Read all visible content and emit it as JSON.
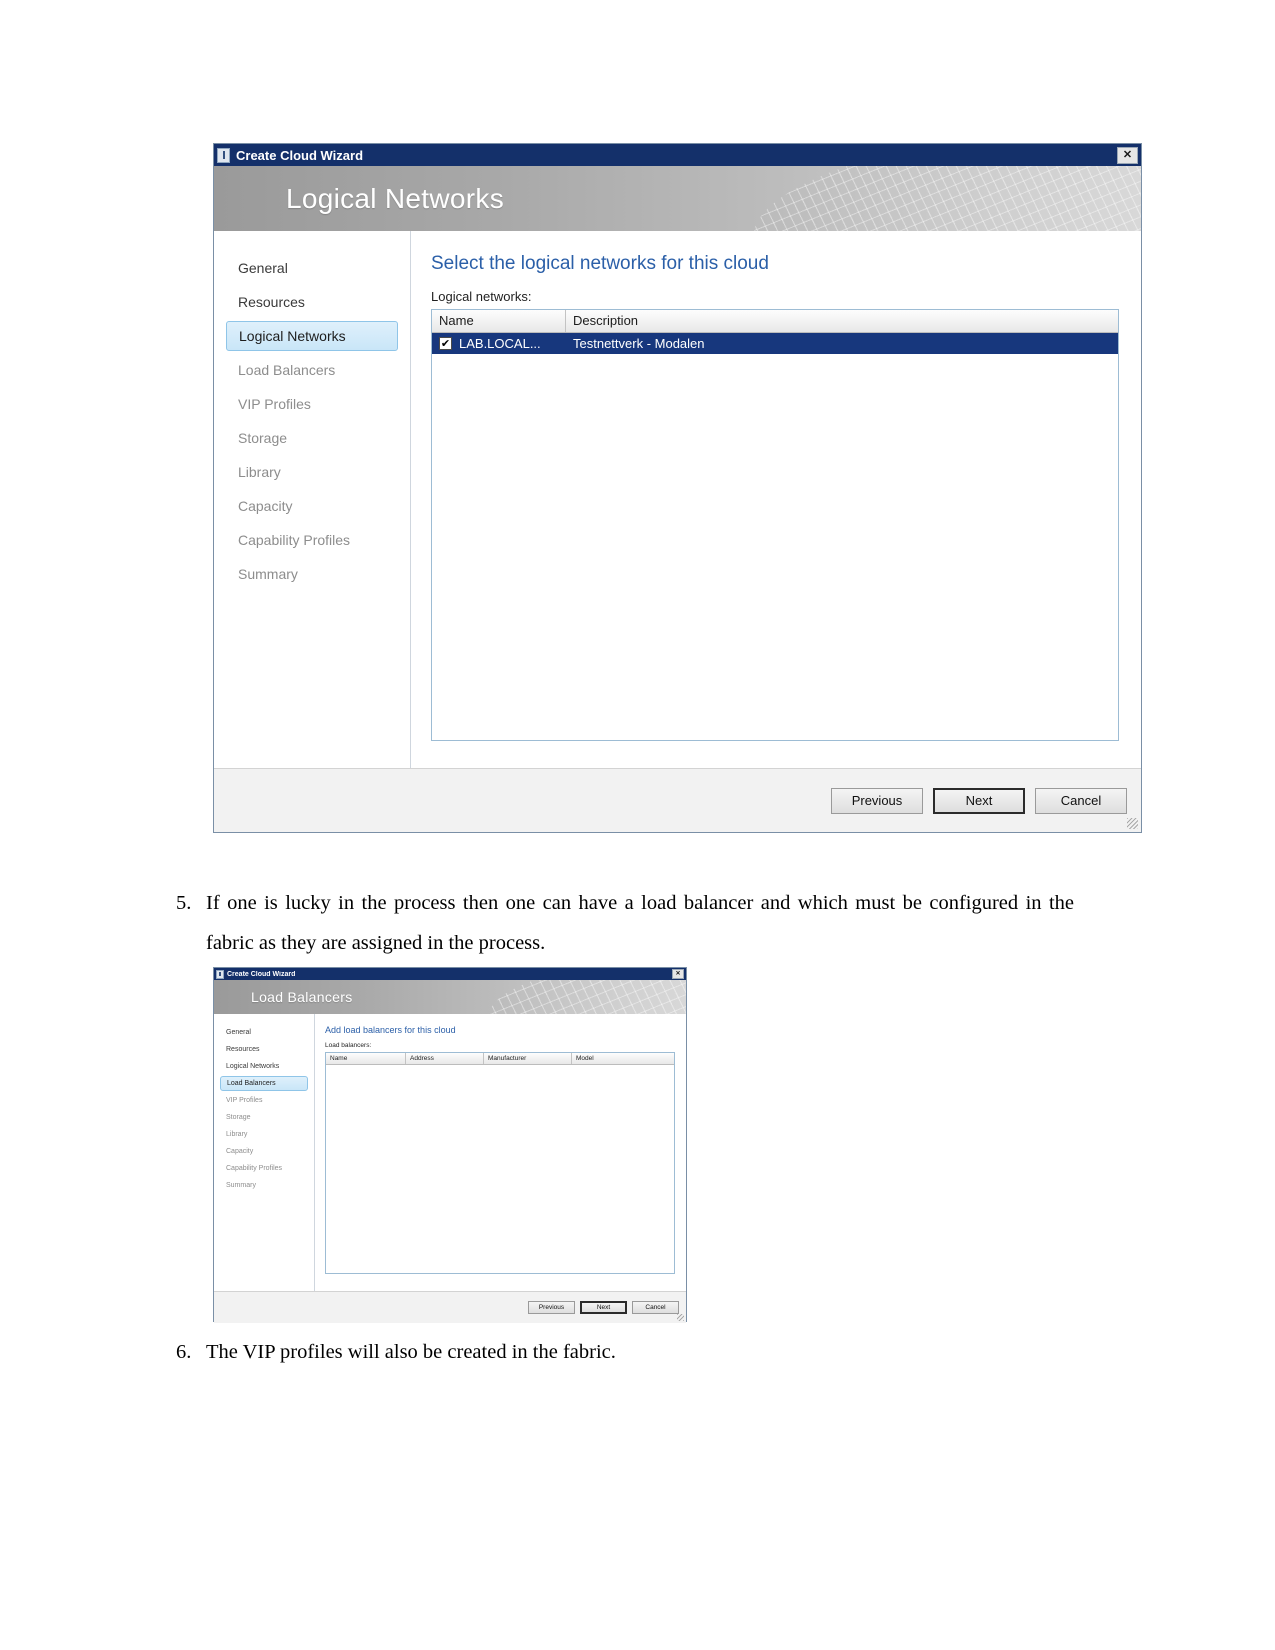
{
  "dialog1": {
    "titlebar": {
      "title": "Create Cloud Wizard",
      "close_label": "✕",
      "icon": "wizard-icon"
    },
    "banner_heading": "Logical Networks",
    "sidebar": {
      "items": [
        {
          "label": "General",
          "state": "normal"
        },
        {
          "label": "Resources",
          "state": "normal"
        },
        {
          "label": "Logical Networks",
          "state": "active"
        },
        {
          "label": "Load Balancers",
          "state": "dim"
        },
        {
          "label": "VIP Profiles",
          "state": "dim"
        },
        {
          "label": "Storage",
          "state": "dim"
        },
        {
          "label": "Library",
          "state": "dim"
        },
        {
          "label": "Capacity",
          "state": "dim"
        },
        {
          "label": "Capability Profiles",
          "state": "dim"
        },
        {
          "label": "Summary",
          "state": "dim"
        }
      ]
    },
    "content": {
      "title": "Select the logical networks for this cloud",
      "list_label": "Logical networks:",
      "columns": [
        "Name",
        "Description"
      ],
      "rows": [
        {
          "checked": "✔",
          "name": "LAB.LOCAL...",
          "description": "Testnettverk - Modalen"
        }
      ]
    },
    "buttons": {
      "previous": "Previous",
      "next": "Next",
      "cancel": "Cancel"
    }
  },
  "dialog2": {
    "titlebar": {
      "title": "Create Cloud Wizard",
      "close_label": "✕",
      "icon": "wizard-icon"
    },
    "banner_heading": "Load Balancers",
    "sidebar": {
      "items": [
        {
          "label": "General",
          "state": "normal"
        },
        {
          "label": "Resources",
          "state": "normal"
        },
        {
          "label": "Logical Networks",
          "state": "normal"
        },
        {
          "label": "Load Balancers",
          "state": "active"
        },
        {
          "label": "VIP Profiles",
          "state": "dim"
        },
        {
          "label": "Storage",
          "state": "dim"
        },
        {
          "label": "Library",
          "state": "dim"
        },
        {
          "label": "Capacity",
          "state": "dim"
        },
        {
          "label": "Capability Profiles",
          "state": "dim"
        },
        {
          "label": "Summary",
          "state": "dim"
        }
      ]
    },
    "content": {
      "title": "Add load balancers for this cloud",
      "list_label": "Load balancers:",
      "columns": [
        "Name",
        "Address",
        "Manufacturer",
        "Model"
      ],
      "rows": []
    },
    "buttons": {
      "previous": "Previous",
      "next": "Next",
      "cancel": "Cancel"
    }
  },
  "document": {
    "item5": {
      "number": "5.",
      "text": "If one is lucky in the process then one can have a load balancer and which must be configured in the fabric as they are assigned in the process."
    },
    "item6": {
      "number": "6.",
      "text": "The VIP profiles will also be created in the fabric."
    }
  },
  "colors": {
    "titlebar_blue": "#14306a",
    "heading_blue": "#2b5fa8",
    "selected_row_blue": "#17377d",
    "active_nav_blue": "#c9e6f8"
  }
}
